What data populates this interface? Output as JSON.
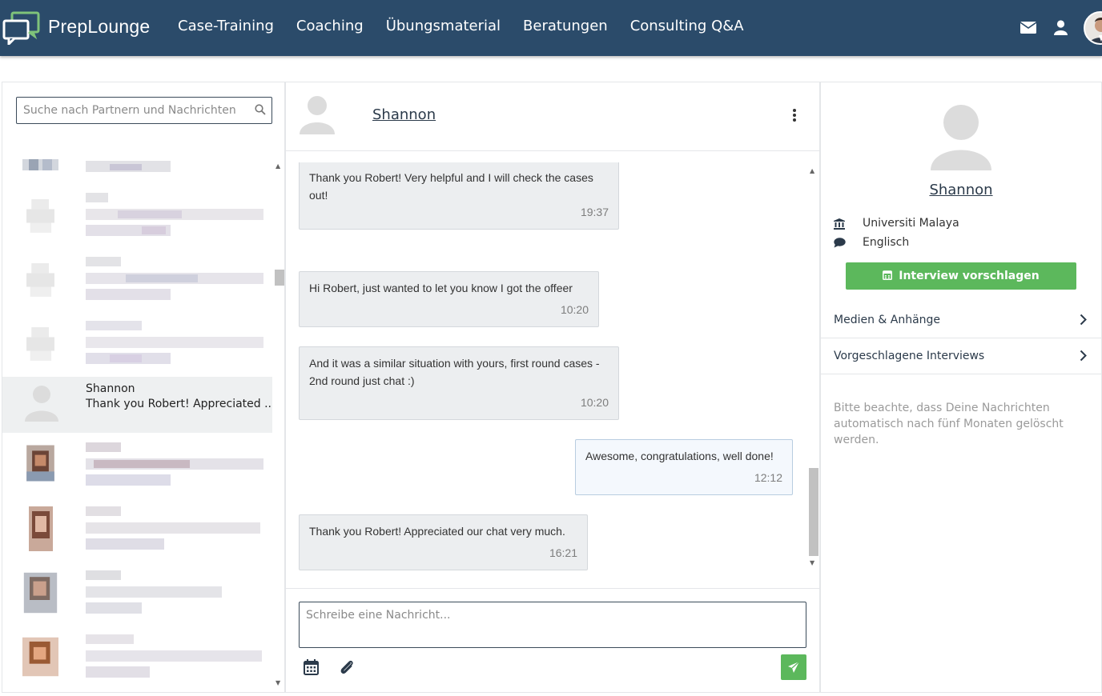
{
  "app": {
    "name": "PrepLounge"
  },
  "nav": {
    "items": [
      "Case-Training",
      "Coaching",
      "Übungsmaterial",
      "Beratungen",
      "Consulting Q&A"
    ]
  },
  "icons": {
    "mail": "envelope-icon",
    "user": "user-icon",
    "avatar": "profile-avatar"
  },
  "colors": {
    "topbar": "#2b4b6a",
    "accent_green": "#5cb85c",
    "active_row": "#eef0f1"
  },
  "sidebar": {
    "search_placeholder": "Suche nach Partnern und Nachrichten",
    "active_contact": {
      "name": "Shannon",
      "preview": "Thank you Robert! Appreciated ..."
    }
  },
  "chat": {
    "partner": "Shannon",
    "messages": [
      {
        "text": "Thank you Robert! Very helpful and I will check the cases out!",
        "time": "19:37",
        "mine": false
      },
      {
        "text": "Hi Robert, just wanted to let you know I got the offeer",
        "time": "10:20",
        "mine": false
      },
      {
        "text": "And it was a similar situation with yours, first round cases - 2nd round just chat :)",
        "time": "10:20",
        "mine": false
      },
      {
        "text": "Awesome, congratulations, well done!",
        "time": "12:12",
        "mine": true
      },
      {
        "text": "Thank you Robert! Appreciated our chat very much.",
        "time": "16:21",
        "mine": false
      }
    ],
    "compose_placeholder": "Schreibe eine Nachricht..."
  },
  "profile": {
    "name": "Shannon",
    "university": "Universiti Malaya",
    "language": "Englisch",
    "interview_button": "Interview vorschlagen",
    "sections": [
      "Medien & Anhänge",
      "Vorgeschlagene Interviews"
    ],
    "note": "Bitte beachte, dass Deine Nachrichten automatisch nach fünf Monaten gelöscht werden."
  }
}
